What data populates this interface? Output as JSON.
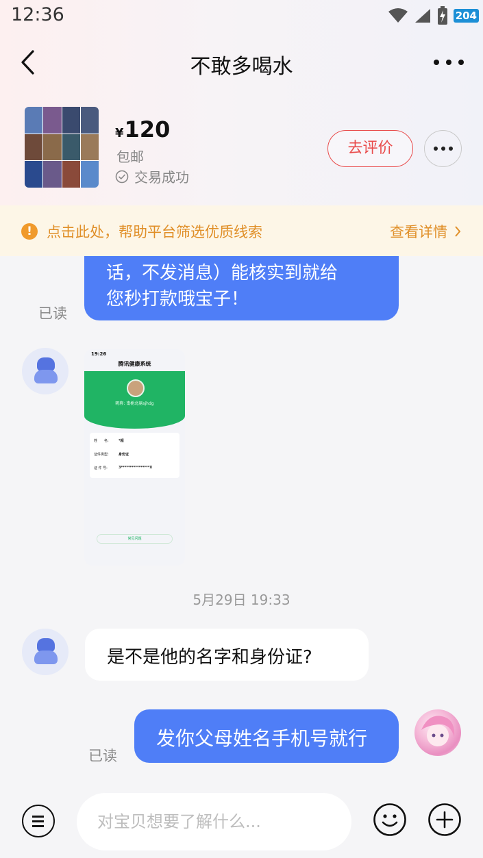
{
  "status_bar": {
    "time": "12:36",
    "battery": "204"
  },
  "header": {
    "title": "不敢多喝水"
  },
  "product": {
    "currency": "¥",
    "price": "120",
    "shipping": "包邮",
    "status": "交易成功",
    "rate_label": "去评价"
  },
  "notice": {
    "text": "点击此处，帮助平台筛选优质线索",
    "link": "查看详情"
  },
  "messages": {
    "m1_line1": "话，不发消息）能核实到就给",
    "m1_line2": "您秒打款哦宝子！",
    "m1_read": "已读",
    "timestamp": "5月29日 19:33",
    "m3_text": "是不是他的名字和身份证?",
    "m4_text": "发你父母姓名手机号就行",
    "m4_read": "已读"
  },
  "screenshot_image": {
    "time": "19:26",
    "title": "腾讯健康系统",
    "nickname": "昵称: 南栀北易sjhdg",
    "row1_label": "姓　　名:",
    "row1_value": "*超",
    "row2_label": "证件类型:",
    "row2_value": "身份证",
    "row3_label": "证 件 号:",
    "row3_value": "3****************X",
    "button": "常见问题"
  },
  "input": {
    "placeholder": "对宝贝想要了解什么..."
  },
  "colors": {
    "accent_blue": "#4f7ef7",
    "rate_red": "#e94c4c",
    "notice_orange": "#e08f28",
    "health_green": "#20b464"
  },
  "icons": [
    "back-arrow-icon",
    "more-dots-icon",
    "check-circle-icon",
    "warning-icon",
    "chevron-right-icon",
    "menu-icon",
    "emoji-icon",
    "plus-icon",
    "wifi-icon",
    "signal-icon",
    "battery-icon"
  ]
}
